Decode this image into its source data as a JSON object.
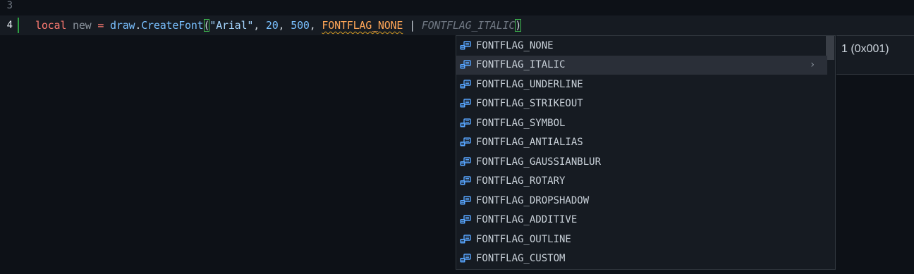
{
  "editor": {
    "lines": [
      {
        "number": "3"
      },
      {
        "number": "4"
      }
    ],
    "code_tokens": {
      "local": "local",
      "var": "new",
      "eq": "=",
      "obj": "draw",
      "dot": ".",
      "fn": "CreateFont",
      "open_paren": "(",
      "str": "\"Arial\"",
      "comma1": ",",
      "n1": "20",
      "comma2": ",",
      "n2": "500",
      "comma3": ",",
      "const": "FONTFLAG_NONE",
      "pipe": "|",
      "ghost": "FONTFLAG_ITALIC",
      "close_paren": ")"
    }
  },
  "suggest": {
    "items": [
      {
        "label": "FONTFLAG_NONE"
      },
      {
        "label": "FONTFLAG_ITALIC"
      },
      {
        "label": "FONTFLAG_UNDERLINE"
      },
      {
        "label": "FONTFLAG_STRIKEOUT"
      },
      {
        "label": "FONTFLAG_SYMBOL"
      },
      {
        "label": "FONTFLAG_ANTIALIAS"
      },
      {
        "label": "FONTFLAG_GAUSSIANBLUR"
      },
      {
        "label": "FONTFLAG_ROTARY"
      },
      {
        "label": "FONTFLAG_DROPSHADOW"
      },
      {
        "label": "FONTFLAG_ADDITIVE"
      },
      {
        "label": "FONTFLAG_OUTLINE"
      },
      {
        "label": "FONTFLAG_CUSTOM"
      }
    ],
    "selected_index": 1,
    "item_icon": "enum-member-icon",
    "chevron": "›"
  },
  "detail": {
    "text": "1 (0x001)"
  },
  "colors": {
    "background": "#0d1117",
    "current_line": "#161b22",
    "keyword": "#ff7b72",
    "function": "#79c0ff",
    "string": "#a5d6ff",
    "constant": "#ffa657",
    "ghost_text": "#6e7681",
    "modified_bar": "#2ea043",
    "icon_blue": "#58a6ff"
  }
}
